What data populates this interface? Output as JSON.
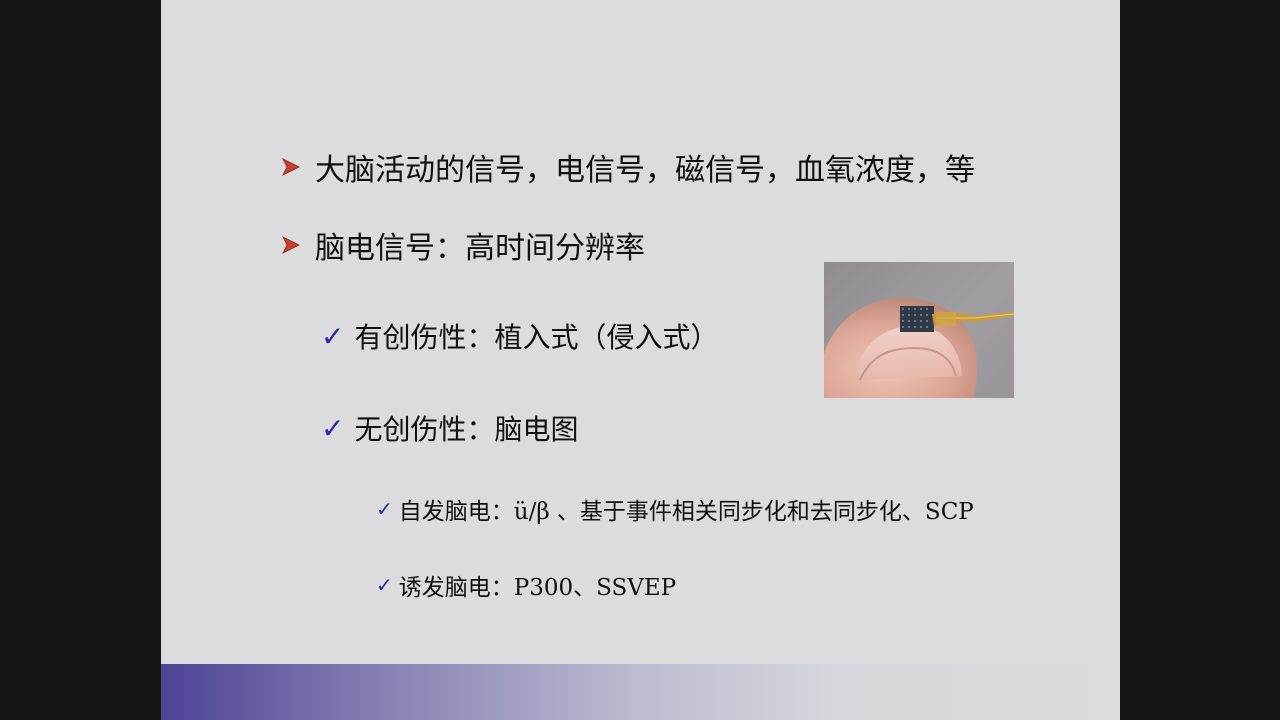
{
  "slide": {
    "bullets": [
      {
        "text": "大脑活动的信号，电信号，磁信号，血氧浓度，等"
      },
      {
        "text": "脑电信号：高时间分辨率"
      }
    ],
    "sub_items": [
      {
        "text": "有创伤性：植入式（侵入式）"
      },
      {
        "text": "无创伤性：脑电图"
      }
    ],
    "sub_sub_items": [
      {
        "text": "自发脑电：ü/β 、基于事件相关同步化和去同步化、SCP"
      },
      {
        "text": "诱发脑电：P300、SSVEP"
      }
    ],
    "bullet_icon": "arrow-bullet-icon",
    "check_icon": "checkmark-icon",
    "colors": {
      "arrow": "#c8402a",
      "check": "#2a2a9a",
      "background": "#dcdbdd",
      "bar_start": "#4c4495"
    }
  }
}
